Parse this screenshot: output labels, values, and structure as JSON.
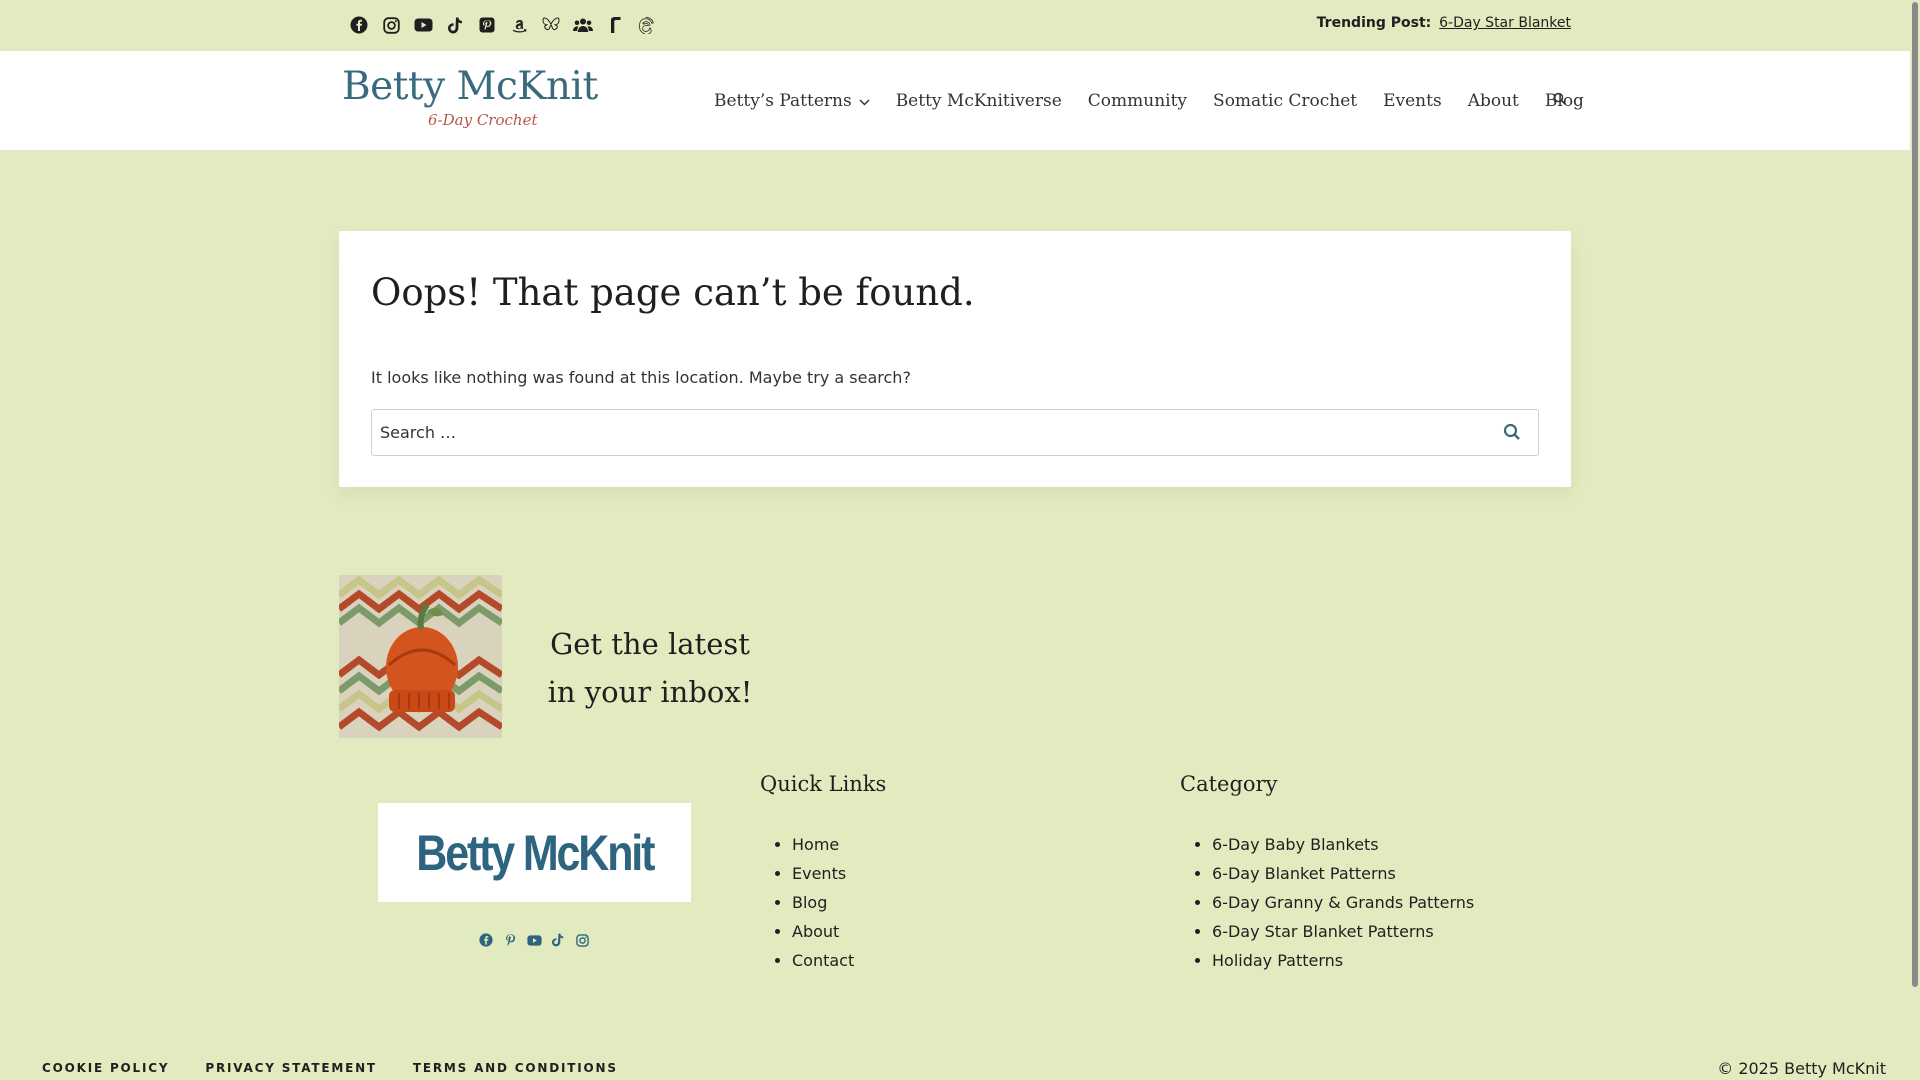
{
  "topbar": {
    "social_icons": [
      "facebook-icon",
      "instagram-icon",
      "youtube-icon",
      "tiktok-icon",
      "pinterest-icon",
      "amazon-icon",
      "bluesky-icon",
      "facebook-group-icon",
      "ravelry-icon",
      "threads-icon"
    ],
    "trending_label": "Trending Post:",
    "trending_link": "6-Day Star Blanket"
  },
  "header": {
    "logo_name": "Betty McKnit",
    "logo_sub": "6-Day Crochet",
    "nav": [
      "Betty’s Patterns",
      "Betty McKnitiverse",
      "Community",
      "Somatic Crochet",
      "Events",
      "About",
      "Blog"
    ]
  },
  "main": {
    "title": "Oops! That page can’t be found.",
    "message": "It looks like nothing was found at this location. Maybe try a search?",
    "search_placeholder": "Search …"
  },
  "newsletter": {
    "line1": "Get the latest",
    "line2": "in your inbox!"
  },
  "footer": {
    "logo_text": "Betty McKnit",
    "social_icons": [
      "facebook-icon",
      "pinterest-icon",
      "youtube-icon",
      "tiktok-icon",
      "instagram-icon"
    ],
    "quick_links_title": "Quick Links",
    "quick_links": [
      "Home",
      "Events",
      "Blog",
      "About",
      "Contact"
    ],
    "category_title": "Category",
    "categories": [
      "6-Day Baby Blankets",
      "6-Day Blanket Patterns",
      "6-Day Granny & Grands Patterns",
      "6-Day Star Blanket Patterns",
      "Holiday Patterns"
    ],
    "bottom_links": [
      "COOKIE POLICY",
      "PRIVACY STATEMENT",
      "TERMS AND CONDITIONS"
    ],
    "copyright": "© 2025 Betty McKnit"
  },
  "colors": {
    "background": "#e2ebbf",
    "logo_blue": "#3a6a7e",
    "logo_accent": "#b8564a"
  }
}
